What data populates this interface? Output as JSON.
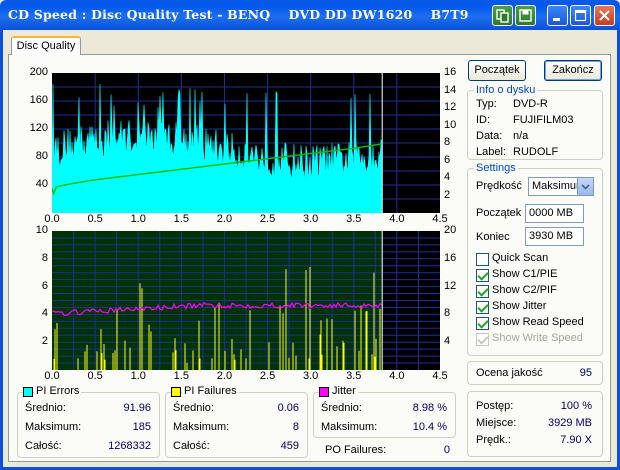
{
  "window": {
    "title": "CD Speed : Disc Quality Test - BENQ    DVD DD DW1620    B7T9",
    "tab": "Disc Quality"
  },
  "buttons": {
    "start": "Początek",
    "end": "Zakończ"
  },
  "disc_info": {
    "title": "Info o dysku",
    "rows": [
      {
        "label": "Typ:",
        "value": "DVD-R"
      },
      {
        "label": "ID:",
        "value": "FUJIFILM03"
      },
      {
        "label": "Data:",
        "value": "n/a"
      },
      {
        "label": "Label:",
        "value": "RUDOLF"
      }
    ]
  },
  "settings": {
    "title": "Settings",
    "speed_label": "Prędkość",
    "speed_value": "Maksimum",
    "start_label": "Początek",
    "start_value": "0000 MB",
    "end_label": "Koniec",
    "end_value": "3930 MB",
    "checks": [
      {
        "label": "Quick Scan",
        "checked": false,
        "disabled": false
      },
      {
        "label": "Show C1/PIE",
        "checked": true,
        "disabled": false
      },
      {
        "label": "Show C2/PIF",
        "checked": true,
        "disabled": false
      },
      {
        "label": "Show Jitter",
        "checked": true,
        "disabled": false
      },
      {
        "label": "Show Read Speed",
        "checked": true,
        "disabled": false
      },
      {
        "label": "Show Write Speed",
        "checked": true,
        "disabled": true
      }
    ]
  },
  "quality": {
    "label": "Ocena jakość",
    "value": "95"
  },
  "progress": {
    "rows": [
      {
        "label": "Postęp:",
        "value": "100 %"
      },
      {
        "label": "Miejsce:",
        "value": "3929 MB"
      },
      {
        "label": "Prędk.:",
        "value": "7.90 X"
      }
    ]
  },
  "stats": {
    "pi_errors": {
      "title": "PI Errors",
      "color": "#00ffff",
      "rows": [
        {
          "label": "Średnio:",
          "value": "91.96"
        },
        {
          "label": "Maksimum:",
          "value": "185"
        },
        {
          "label": "Całość:",
          "value": "1268332"
        }
      ]
    },
    "pi_failures": {
      "title": "PI Failures",
      "color": "#ffff00",
      "rows": [
        {
          "label": "Średnio:",
          "value": "0.06"
        },
        {
          "label": "Maksimum:",
          "value": "8"
        },
        {
          "label": "Całość:",
          "value": "459"
        }
      ]
    },
    "jitter": {
      "title": "Jitter",
      "color": "#ff00ff",
      "rows": [
        {
          "label": "Średnio:",
          "value": "8.98 %"
        },
        {
          "label": "Maksimum:",
          "value": "10.4 %"
        }
      ]
    },
    "po_failures": {
      "label": "PO Failures:",
      "value": "0"
    }
  },
  "chart_data": [
    {
      "type": "area",
      "title": "",
      "x_ticks": [
        "0.0",
        "0.5",
        "1.0",
        "1.5",
        "2.0",
        "2.5",
        "3.0",
        "3.5",
        "4.0",
        "4.5"
      ],
      "y_left_ticks": [
        "40",
        "80",
        "120",
        "160",
        "200"
      ],
      "y_right_ticks": [
        "2",
        "4",
        "6",
        "8",
        "10",
        "12",
        "14",
        "16"
      ],
      "xlim": [
        0,
        4.5
      ],
      "ylim_left": [
        0,
        200
      ],
      "ylim_right": [
        0,
        16
      ],
      "data_end_x": 3.83,
      "series": [
        {
          "name": "PI Errors",
          "color": "#00ffff",
          "avg": 91.96,
          "max": 185
        },
        {
          "color": "#00c000",
          "x": [
            0.0,
            0.02,
            0.05,
            0.2,
            0.5,
            1.0,
            1.5,
            2.0,
            2.5,
            3.0,
            3.5,
            3.83
          ],
          "y": [
            2.8,
            2.2,
            3.0,
            3.3,
            3.8,
            4.4,
            5.0,
            5.6,
            6.2,
            6.8,
            7.4,
            7.9
          ]
        }
      ],
      "grid": true
    },
    {
      "type": "bar",
      "title": "",
      "x_ticks": [
        "0.0",
        "0.5",
        "1.0",
        "1.5",
        "2.0",
        "2.5",
        "3.0",
        "3.5",
        "4.0",
        "4.5"
      ],
      "y_left_ticks": [
        "2",
        "4",
        "6",
        "8",
        "10"
      ],
      "y_right_ticks": [
        "4",
        "8",
        "12",
        "16",
        "20"
      ],
      "xlim": [
        0,
        4.5
      ],
      "ylim_left": [
        0,
        10
      ],
      "ylim_right": [
        0,
        20
      ],
      "data_end_x": 3.83,
      "series": [
        {
          "name": "PI Failures",
          "color": "#ffff00",
          "avg": 0.06,
          "max": 8
        },
        {
          "name": "Jitter",
          "color": "#ff00ff",
          "avg": 8.98,
          "max": 10.4
        }
      ],
      "grid": true
    }
  ]
}
